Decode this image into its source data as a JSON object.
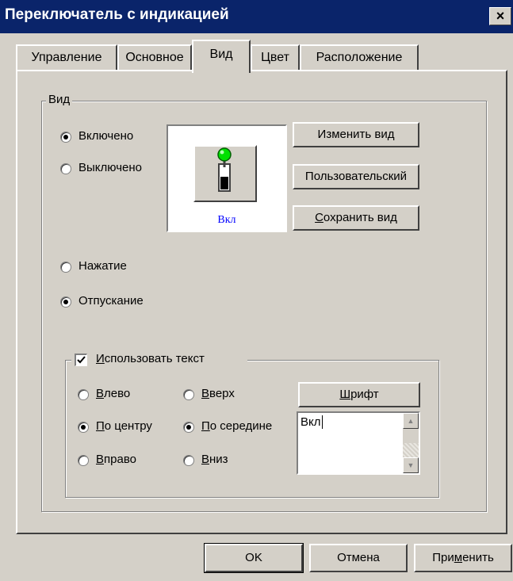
{
  "window": {
    "title": "Переключатель с индикацией",
    "close_glyph": "×"
  },
  "tabs": [
    {
      "label": "Управление"
    },
    {
      "label": "Основное"
    },
    {
      "label": "Вид"
    },
    {
      "label": "Цвет"
    },
    {
      "label": "Расположение"
    }
  ],
  "view_group": {
    "label": "Вид",
    "state_on": "Включено",
    "state_off": "Выключено",
    "mode_press": "Нажатие",
    "mode_release": "Отпускание",
    "preview_caption": "Вкл",
    "change_view_button": "Изменить вид",
    "custom_button": "Пользовательский",
    "save_view_prefix": "С",
    "save_view_rest": "охранить вид"
  },
  "text_group": {
    "checkbox_prefix": "И",
    "checkbox_rest": "спользовать текст",
    "left_u": "В",
    "left_rest": "лево",
    "center_u": "П",
    "center_rest": "о центру",
    "right_u": "В",
    "right_rest": "право",
    "top_u": "В",
    "top_rest": "верх",
    "middle_u": "П",
    "middle_rest": "о середине",
    "bottom_u": "В",
    "bottom_rest": "низ",
    "font_u": "Ш",
    "font_rest": "рифт",
    "text_value": "Вкл"
  },
  "footer": {
    "ok": "OK",
    "cancel": "Отмена",
    "apply_pre": "При",
    "apply_u": "м",
    "apply_post": "енить"
  },
  "colors": {
    "titlebar": "#0a246a",
    "face": "#d4d0c8",
    "lamp": "#00e000",
    "caption": "#0000ff"
  }
}
